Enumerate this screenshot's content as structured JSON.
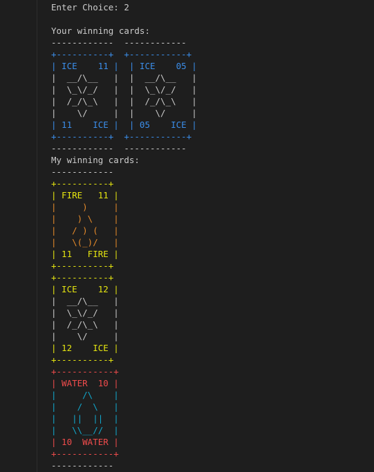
{
  "prompt": "Enter Choice: 2",
  "your_heading": "Your winning cards:",
  "my_heading": "My winning cards:",
  "dashes": "------------",
  "dashes_pair": "------------  ------------",
  "your_cards": {
    "top_border": "+----------+  +-----------+",
    "bottom_border": "+----------+  +-----------+",
    "rows": [
      "| ICE    11 |  | ICE    05 |",
      "|  __/\\__   |  |  __/\\__   |",
      "|  \\_\\/_/   |  |  \\_\\/_/   |",
      "|  /_/\\_\\   |  |  /_/\\_\\   |",
      "|    \\/     |  |    \\/     |",
      "| 11    ICE |  | 05    ICE |"
    ]
  },
  "my_cards": [
    {
      "name": "FIRE",
      "color": "#e5e510",
      "art_color": "#e58a2a",
      "border": "+----------+",
      "rows": [
        "| FIRE   11 |",
        "|     )     |",
        "|    ) \\    |",
        "|   / ) (   |",
        "|   \\(_)/   |",
        "| 11   FIRE |"
      ]
    },
    {
      "name": "ICE",
      "color": "#e5e510",
      "art_color": "#cccccc",
      "border": "+----------+",
      "rows": [
        "| ICE    12 |",
        "|  __/\\__   |",
        "|  \\_\\/_/   |",
        "|  /_/\\_\\   |",
        "|    \\/     |",
        "| 12    ICE |"
      ]
    },
    {
      "name": "WATER",
      "color": "#f14c4c",
      "art_color": "#11a8cd",
      "border": "+-----------+",
      "rows": [
        "| WATER  10 |",
        "|     /\\    |",
        "|    /  \\   |",
        "|   ||  ||  |",
        "|   \\\\__//  |",
        "| 10  WATER |"
      ]
    }
  ]
}
